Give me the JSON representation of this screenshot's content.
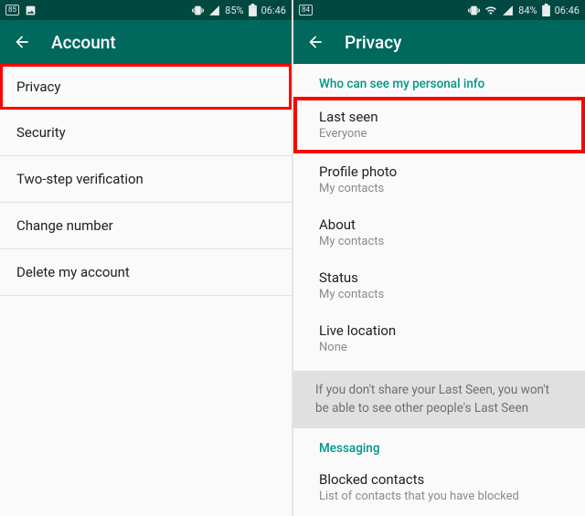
{
  "left": {
    "status": {
      "notif": "85",
      "battery": "85%",
      "time": "06:46"
    },
    "title": "Account",
    "items": [
      "Privacy",
      "Security",
      "Two-step verification",
      "Change number",
      "Delete my account"
    ]
  },
  "right": {
    "status": {
      "notif": "84",
      "battery": "84%",
      "time": "06:46"
    },
    "title": "Privacy",
    "section1": "Who can see my personal info",
    "prefs": [
      {
        "label": "Last seen",
        "value": "Everyone"
      },
      {
        "label": "Profile photo",
        "value": "My contacts"
      },
      {
        "label": "About",
        "value": "My contacts"
      },
      {
        "label": "Status",
        "value": "My contacts"
      },
      {
        "label": "Live location",
        "value": "None"
      }
    ],
    "info": "If you don't share your Last Seen, you won't be able to see other people's Last Seen",
    "section2": "Messaging",
    "blocked": {
      "label": "Blocked contacts",
      "sub": "List of contacts that you have blocked"
    }
  }
}
